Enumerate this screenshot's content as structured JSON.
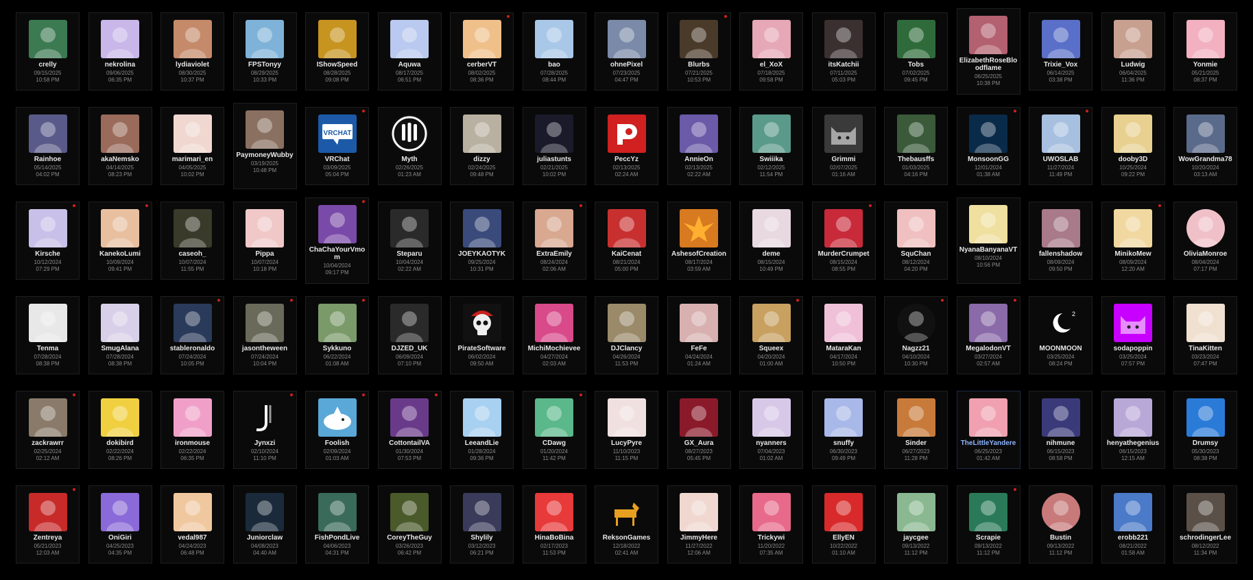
{
  "colors": {
    "background": "#000000",
    "card_bg": "#0a0a0a",
    "card_border": "#1f1f1f",
    "name": "#e8e8e8",
    "name_highlight": "#8db4ff",
    "meta": "#8b8b8b",
    "badge": "#d02020"
  },
  "streamers": [
    {
      "name": "crelly",
      "date": "09/15/2025",
      "time": "10:58 PM",
      "color": "#3c7a52",
      "icon": "avatar-icon"
    },
    {
      "name": "nekrolina",
      "date": "09/06/2025",
      "time": "06:35 PM",
      "color": "#c9b7ea",
      "icon": "avatar-icon"
    },
    {
      "name": "lydiaviolet",
      "date": "08/30/2025",
      "time": "10:37 PM",
      "color": "#c58a6a",
      "icon": "avatar-icon"
    },
    {
      "name": "FPSTonyy",
      "date": "08/29/2025",
      "time": "10:33 PM",
      "color": "#7fb2d8",
      "icon": "avatar-icon"
    },
    {
      "name": "IShowSpeed",
      "date": "08/28/2025",
      "time": "09:08 PM",
      "color": "#c7941f",
      "icon": "avatar-icon"
    },
    {
      "name": "Aquwa",
      "date": "08/17/2025",
      "time": "06:51 PM",
      "color": "#b9c9ef",
      "icon": "avatar-icon"
    },
    {
      "name": "cerberVT",
      "date": "08/02/2025",
      "time": "08:36 PM",
      "color": "#f0c08a",
      "icon": "avatar-icon",
      "badge": true
    },
    {
      "name": "bao",
      "date": "07/28/2025",
      "time": "08:44 PM",
      "color": "#a9c8e8",
      "icon": "avatar-icon"
    },
    {
      "name": "ohnePixel",
      "date": "07/23/2025",
      "time": "04:47 PM",
      "color": "#7a8aa8",
      "icon": "avatar-icon"
    },
    {
      "name": "Blurbs",
      "date": "07/21/2025",
      "time": "10:53 PM",
      "color": "#4a3a2a",
      "icon": "avatar-icon",
      "badge": true
    },
    {
      "name": "el_XoX",
      "date": "07/18/2025",
      "time": "09:58 PM",
      "color": "#e6a7b6",
      "icon": "avatar-icon"
    },
    {
      "name": "itsKatchii",
      "date": "07/11/2025",
      "time": "05:03 PM",
      "color": "#3b3030",
      "icon": "avatar-icon"
    },
    {
      "name": "Tobs",
      "date": "07/02/2025",
      "time": "09:45 PM",
      "color": "#2f6b3a",
      "icon": "avatar-icon"
    },
    {
      "name": "ElizabethRoseBloodflame",
      "date": "06/25/2025",
      "time": "10:38 PM",
      "color": "#b36070",
      "icon": "avatar-icon",
      "tall": true
    },
    {
      "name": "Trixie_Vox",
      "date": "06/14/2025",
      "time": "03:38 PM",
      "color": "#5a6fc8",
      "icon": "avatar-icon"
    },
    {
      "name": "Ludwig",
      "date": "06/04/2025",
      "time": "11:36 PM",
      "color": "#c8a090",
      "icon": "avatar-icon"
    },
    {
      "name": "Yonmie",
      "date": "05/21/2025",
      "time": "08:37 PM",
      "color": "#f2b0c0",
      "icon": "avatar-icon"
    },
    {
      "name": "Rainhoe",
      "date": "05/14/2025",
      "time": "04:02 PM",
      "color": "#5a5a8a",
      "icon": "avatar-icon"
    },
    {
      "name": "akaNemsko",
      "date": "04/14/2025",
      "time": "08:23 PM",
      "color": "#9a6a5a",
      "icon": "avatar-icon"
    },
    {
      "name": "marimari_en",
      "date": "04/05/2025",
      "time": "10:02 PM",
      "color": "#f0d8d0",
      "icon": "avatar-icon"
    },
    {
      "name": "PaymoneyWubby",
      "date": "03/19/2025",
      "time": "10:48 PM",
      "color": "#8a7060",
      "icon": "avatar-icon",
      "tall": true
    },
    {
      "name": "VRChat",
      "date": "03/09/2025",
      "time": "05:04 PM",
      "color": "#1c5aa8",
      "icon": "vrchat-logo-icon",
      "badge": true
    },
    {
      "name": "Myth",
      "date": "02/26/2025",
      "time": "01:23 AM",
      "color": "#111111",
      "icon": "claw-logo-icon",
      "round": true
    },
    {
      "name": "dizzy",
      "date": "02/24/2025",
      "time": "09:48 PM",
      "color": "#b8b0a0",
      "icon": "avatar-icon"
    },
    {
      "name": "juliastunts",
      "date": "02/21/2025",
      "time": "10:02 PM",
      "color": "#1a1a2a",
      "icon": "avatar-icon"
    },
    {
      "name": "PeccYz",
      "date": "02/13/2025",
      "time": "02:24 AM",
      "color": "#d02020",
      "icon": "p-logo-icon"
    },
    {
      "name": "AnnieOn",
      "date": "02/13/2025",
      "time": "02:22 AM",
      "color": "#6a5aa8",
      "icon": "avatar-icon"
    },
    {
      "name": "Swiiika",
      "date": "02/12/2025",
      "time": "11:54 PM",
      "color": "#5a9a8a",
      "icon": "avatar-icon"
    },
    {
      "name": "Grimmi",
      "date": "02/07/2025",
      "time": "01:16 AM",
      "color": "#3a3a3a",
      "icon": "cat-icon"
    },
    {
      "name": "Thebausffs",
      "date": "01/03/2025",
      "time": "04:16 PM",
      "color": "#3a5a3a",
      "icon": "avatar-icon"
    },
    {
      "name": "MonsoonGG",
      "date": "12/01/2024",
      "time": "01:38 AM",
      "color": "#0a2a4a",
      "icon": "avatar-icon",
      "badge": true
    },
    {
      "name": "UWOSLAB",
      "date": "11/27/2024",
      "time": "11:49 PM",
      "color": "#a8c0e0",
      "icon": "avatar-icon",
      "badge": true
    },
    {
      "name": "dooby3D",
      "date": "10/25/2024",
      "time": "09:22 PM",
      "color": "#e8d090",
      "icon": "avatar-icon"
    },
    {
      "name": "WowGrandma78",
      "date": "10/20/2024",
      "time": "03:13 AM",
      "color": "#5a6a8a",
      "icon": "avatar-icon"
    },
    {
      "name": "Kirsche",
      "date": "10/12/2024",
      "time": "07:29 PM",
      "color": "#c8c0e8",
      "icon": "avatar-icon",
      "badge": true
    },
    {
      "name": "KanekoLumi",
      "date": "10/09/2024",
      "time": "09:41 PM",
      "color": "#e8c0a0",
      "icon": "avatar-icon",
      "badge": true
    },
    {
      "name": "caseoh_",
      "date": "10/07/2024",
      "time": "11:55 PM",
      "color": "#3a3a2a",
      "icon": "avatar-icon"
    },
    {
      "name": "Pippa",
      "date": "10/07/2024",
      "time": "10:18 PM",
      "color": "#f0c8c8",
      "icon": "avatar-icon"
    },
    {
      "name": "ChaChaYourVmom",
      "date": "10/04/2024",
      "time": "09:17 PM",
      "color": "#7a4aa8",
      "icon": "avatar-icon",
      "tall": true,
      "badge": true
    },
    {
      "name": "Steparu",
      "date": "10/04/2024",
      "time": "02:22 AM",
      "color": "#2a2a2a",
      "icon": "avatar-icon"
    },
    {
      "name": "JOEYKAOTYK",
      "date": "09/25/2024",
      "time": "10:31 PM",
      "color": "#3a4a7a",
      "icon": "avatar-icon"
    },
    {
      "name": "ExtraEmily",
      "date": "08/24/2024",
      "time": "02:06 AM",
      "color": "#d8a890",
      "icon": "avatar-icon",
      "badge": true
    },
    {
      "name": "KaiCenat",
      "date": "08/21/2024",
      "time": "05:00 PM",
      "color": "#c83030",
      "icon": "avatar-icon"
    },
    {
      "name": "AshesofCreation",
      "date": "08/17/2024",
      "time": "03:59 AM",
      "color": "#d87a20",
      "icon": "phoenix-logo-icon"
    },
    {
      "name": "deme",
      "date": "08/15/2024",
      "time": "10:49 PM",
      "color": "#e8d8e0",
      "icon": "avatar-icon"
    },
    {
      "name": "MurderCrumpet",
      "date": "08/15/2024",
      "time": "08:55 PM",
      "color": "#c82a3a",
      "icon": "avatar-icon",
      "badge": true
    },
    {
      "name": "SquChan",
      "date": "08/12/2024",
      "time": "04:20 PM",
      "color": "#f0c0c0",
      "icon": "avatar-icon"
    },
    {
      "name": "NyanaBanyanaVT",
      "date": "08/10/2024",
      "time": "10:56 PM",
      "color": "#f0e0a0",
      "icon": "avatar-icon",
      "tall": true
    },
    {
      "name": "fallenshadow",
      "date": "08/09/2024",
      "time": "09:50 PM",
      "color": "#a87a8a",
      "icon": "avatar-icon"
    },
    {
      "name": "MinikoMew",
      "date": "08/09/2024",
      "time": "12:20 AM",
      "color": "#f0d8a0",
      "icon": "avatar-icon",
      "badge": true
    },
    {
      "name": "OliviaMonroe",
      "date": "08/04/2024",
      "time": "07:17 PM",
      "color": "#f0c0c8",
      "icon": "avatar-icon",
      "round": true
    },
    {
      "name": "Tenma",
      "date": "07/28/2024",
      "time": "08:38 PM",
      "color": "#e8e8e8",
      "icon": "avatar-icon"
    },
    {
      "name": "SmugAlana",
      "date": "07/28/2024",
      "time": "08:38 PM",
      "color": "#d8d0e8",
      "icon": "avatar-icon"
    },
    {
      "name": "stableronaldo",
      "date": "07/24/2024",
      "time": "10:05 PM",
      "color": "#2a3a5a",
      "icon": "avatar-icon",
      "badge": true
    },
    {
      "name": "jasontheween",
      "date": "07/24/2024",
      "time": "10:04 PM",
      "color": "#6a6a5a",
      "icon": "avatar-icon",
      "badge": true
    },
    {
      "name": "Sykkuno",
      "date": "06/22/2024",
      "time": "01:08 AM",
      "color": "#7a9a6a",
      "icon": "avatar-icon",
      "badge": true
    },
    {
      "name": "DJZED_UK",
      "date": "06/09/2024",
      "time": "07:10 PM",
      "color": "#2a2a2a",
      "icon": "avatar-icon"
    },
    {
      "name": "PirateSoftware",
      "date": "06/02/2024",
      "time": "09:50 AM",
      "color": "#111111",
      "icon": "skull-icon"
    },
    {
      "name": "MichiMochievee",
      "date": "04/27/2024",
      "time": "02:03 AM",
      "color": "#d84a8a",
      "icon": "avatar-icon"
    },
    {
      "name": "DJClancy",
      "date": "04/26/2024",
      "time": "11:53 PM",
      "color": "#9a8a6a",
      "icon": "avatar-icon"
    },
    {
      "name": "FeFe",
      "date": "04/24/2024",
      "time": "01:24 AM",
      "color": "#d8b0b0",
      "icon": "avatar-icon"
    },
    {
      "name": "Squeex",
      "date": "04/20/2024",
      "time": "01:00 AM",
      "color": "#c8a060",
      "icon": "avatar-icon",
      "badge": true
    },
    {
      "name": "MataraKan",
      "date": "04/17/2024",
      "time": "10:50 PM",
      "color": "#f0c0d8",
      "icon": "avatar-icon"
    },
    {
      "name": "Nagzz21",
      "date": "04/10/2024",
      "time": "10:30 PM",
      "color": "#111111",
      "icon": "avatar-icon",
      "round": true,
      "badge": true
    },
    {
      "name": "MegalodonVT",
      "date": "03/27/2024",
      "time": "02:57 AM",
      "color": "#8a6aa8",
      "icon": "avatar-icon",
      "badge": true
    },
    {
      "name": "MOONMOON",
      "date": "03/25/2024",
      "time": "08:24 PM",
      "color": "#0a0a0a",
      "icon": "moon-icon"
    },
    {
      "name": "sodapoppin",
      "date": "03/25/2024",
      "time": "07:57 PM",
      "color": "#c800ff",
      "icon": "cat-icon"
    },
    {
      "name": "TinaKitten",
      "date": "03/23/2024",
      "time": "07:47 PM",
      "color": "#f0e0d0",
      "icon": "avatar-icon"
    },
    {
      "name": "zackrawrr",
      "date": "02/25/2024",
      "time": "02:12 AM",
      "color": "#8a7a6a",
      "icon": "avatar-icon",
      "badge": true
    },
    {
      "name": "dokibird",
      "date": "02/22/2024",
      "time": "08:26 PM",
      "color": "#f0d040",
      "icon": "avatar-icon"
    },
    {
      "name": "ironmouse",
      "date": "02/22/2024",
      "time": "06:35 PM",
      "color": "#f0a0c8",
      "icon": "avatar-icon"
    },
    {
      "name": "Jynxzi",
      "date": "02/10/2024",
      "time": "11:10 PM",
      "color": "#0a0a0a",
      "icon": "j-logo-icon",
      "badge": true
    },
    {
      "name": "Foolish",
      "date": "02/09/2024",
      "time": "01:03 AM",
      "color": "#5aa8d8",
      "icon": "shark-icon",
      "badge": true
    },
    {
      "name": "CottontailVA",
      "date": "01/30/2024",
      "time": "07:53 PM",
      "color": "#6a3a8a",
      "icon": "avatar-icon",
      "badge": true
    },
    {
      "name": "LeeandLie",
      "date": "01/28/2024",
      "time": "09:36 PM",
      "color": "#a8d0f0",
      "icon": "avatar-icon"
    },
    {
      "name": "CDawg",
      "date": "01/20/2024",
      "time": "11:42 PM",
      "color": "#5ab88a",
      "icon": "avatar-icon",
      "badge": true
    },
    {
      "name": "LucyPyre",
      "date": "11/10/2023",
      "time": "11:15 PM",
      "color": "#f0e0e0",
      "icon": "avatar-icon"
    },
    {
      "name": "GX_Aura",
      "date": "08/27/2023",
      "time": "05:45 PM",
      "color": "#8a1a2a",
      "icon": "avatar-icon"
    },
    {
      "name": "nyanners",
      "date": "07/04/2023",
      "time": "01:02 AM",
      "color": "#d8c8e8",
      "icon": "avatar-icon"
    },
    {
      "name": "snuffy",
      "date": "06/30/2023",
      "time": "09:49 PM",
      "color": "#a8b8e8",
      "icon": "avatar-icon"
    },
    {
      "name": "Sinder",
      "date": "06/27/2023",
      "time": "11:28 PM",
      "color": "#c87a3a",
      "icon": "avatar-icon"
    },
    {
      "name": "TheLittleYandere",
      "date": "06/25/2023",
      "time": "01:42 AM",
      "color": "#f0a0b0",
      "icon": "avatar-icon",
      "highlight": true
    },
    {
      "name": "nihmune",
      "date": "06/15/2023",
      "time": "08:58 PM",
      "color": "#3a3a7a",
      "icon": "avatar-icon"
    },
    {
      "name": "henyathegenius",
      "date": "06/15/2023",
      "time": "12:15 AM",
      "color": "#b8a8d8",
      "icon": "avatar-icon"
    },
    {
      "name": "Drumsy",
      "date": "05/30/2023",
      "time": "08:38 PM",
      "color": "#2a7ad8",
      "icon": "avatar-icon"
    },
    {
      "name": "Zentreya",
      "date": "05/21/2023",
      "time": "12:03 AM",
      "color": "#c82a2a",
      "icon": "avatar-icon",
      "badge": true
    },
    {
      "name": "OniGiri",
      "date": "04/25/2023",
      "time": "04:35 PM",
      "color": "#8a6ad8",
      "icon": "avatar-icon"
    },
    {
      "name": "vedal987",
      "date": "04/24/2023",
      "time": "06:48 PM",
      "color": "#f0c8a0",
      "icon": "avatar-icon"
    },
    {
      "name": "Juniorclaw",
      "date": "04/08/2023",
      "time": "04:40 AM",
      "color": "#1a2a3a",
      "icon": "avatar-icon"
    },
    {
      "name": "FishPondLive",
      "date": "04/06/2023",
      "time": "04:31 PM",
      "color": "#3a6a5a",
      "icon": "avatar-icon"
    },
    {
      "name": "CoreyTheGuy",
      "date": "03/26/2023",
      "time": "06:42 PM",
      "color": "#4a5a2a",
      "icon": "avatar-icon"
    },
    {
      "name": "Shylily",
      "date": "03/12/2023",
      "time": "06:21 PM",
      "color": "#3a3a5a",
      "icon": "avatar-icon"
    },
    {
      "name": "HinaBoBina",
      "date": "02/17/2023",
      "time": "11:53 PM",
      "color": "#e83a3a",
      "icon": "avatar-icon"
    },
    {
      "name": "ReksonGames",
      "date": "12/18/2022",
      "time": "02:41 AM",
      "color": "#0a0a0a",
      "icon": "dog-icon"
    },
    {
      "name": "JimmyHere",
      "date": "11/27/2022",
      "time": "12:06 AM",
      "color": "#f0d8d0",
      "icon": "avatar-icon"
    },
    {
      "name": "Trickywi",
      "date": "11/20/2022",
      "time": "07:35 AM",
      "color": "#e86a8a",
      "icon": "avatar-icon"
    },
    {
      "name": "EllyEN",
      "date": "10/22/2022",
      "time": "01:10 AM",
      "color": "#d82a2a",
      "icon": "avatar-icon"
    },
    {
      "name": "jaycgee",
      "date": "09/13/2022",
      "time": "11:12 PM",
      "color": "#8ab890",
      "icon": "avatar-icon"
    },
    {
      "name": "Scrapie",
      "date": "09/13/2022",
      "time": "11:12 PM",
      "color": "#2a7a5a",
      "icon": "avatar-icon",
      "badge": true
    },
    {
      "name": "Bustin",
      "date": "09/13/2022",
      "time": "11:12 PM",
      "color": "#c87a7a",
      "icon": "avatar-icon",
      "round": true
    },
    {
      "name": "erobb221",
      "date": "08/21/2022",
      "time": "01:58 AM",
      "color": "#4a7ac8",
      "icon": "avatar-icon"
    },
    {
      "name": "schrodingerLee",
      "date": "08/12/2022",
      "time": "11:34 PM",
      "color": "#5a5048",
      "icon": "avatar-icon"
    }
  ]
}
